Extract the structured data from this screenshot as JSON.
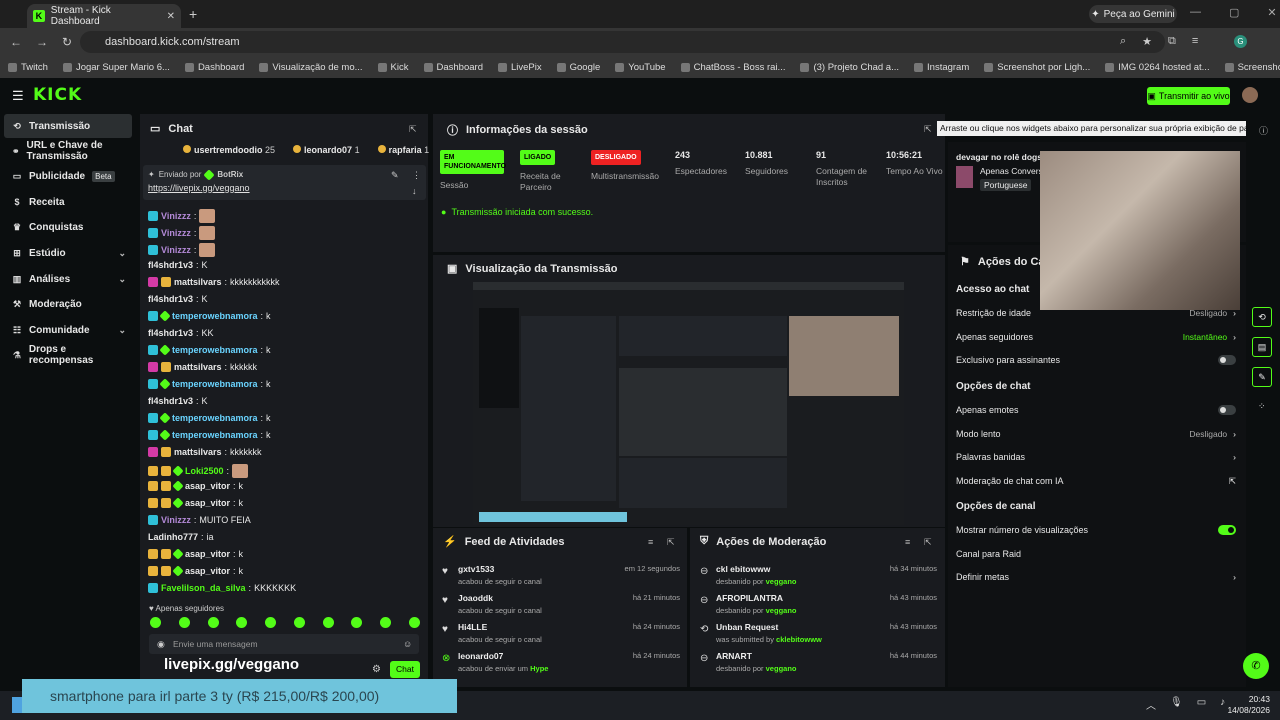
{
  "browser": {
    "tab_title": "Stream - Kick Dashboard",
    "gemini_label": "Peça ao Gemini",
    "url": "dashboard.kick.com/stream",
    "bookmarks": [
      "Twitch",
      "Jogar Super Mario 6...",
      "Dashboard",
      "Visualização de mo...",
      "Kick",
      "Dashboard",
      "LivePix",
      "Google",
      "YouTube",
      "ChatBoss - Boss rai...",
      "(3) Projeto Chad a...",
      "Instagram",
      "Screenshot por Ligh...",
      "IMG 0264 hosted at...",
      "Screenshot por Ligh..."
    ]
  },
  "header": {
    "logo": "KICK",
    "live_button": "Transmitir ao vivo"
  },
  "sidebar": {
    "items": [
      {
        "label": "Transmissão",
        "icon": "broadcast-icon"
      },
      {
        "label": "URL e Chave de Transmissão",
        "icon": "key-icon"
      },
      {
        "label": "Publicidade",
        "icon": "ads-icon",
        "badge": "Beta"
      },
      {
        "label": "Receita",
        "icon": "dollar-icon"
      },
      {
        "label": "Conquistas",
        "icon": "trophy-icon"
      },
      {
        "label": "Estúdio",
        "icon": "studio-icon"
      },
      {
        "label": "Análises",
        "icon": "chart-icon"
      },
      {
        "label": "Moderação",
        "icon": "hammer-icon"
      },
      {
        "label": "Comunidade",
        "icon": "community-icon"
      },
      {
        "label": "Drops e recompensas",
        "icon": "gift-icon"
      }
    ]
  },
  "chat": {
    "title": "Chat",
    "gifters": [
      {
        "name": "usertremdoodio",
        "count": "25"
      },
      {
        "name": "leonardo07",
        "count": "1"
      },
      {
        "name": "rapfaria",
        "count": "1"
      }
    ],
    "pinned": {
      "sent_by": "Enviado por",
      "bot": "BotRix",
      "link": "https://livepix.gg/veggano"
    },
    "messages": [
      {
        "user": "Vinizzz",
        "text": "",
        "color": "#b48ad8",
        "emote": true
      },
      {
        "user": "Vinizzz",
        "text": "",
        "color": "#b48ad8",
        "emote": true
      },
      {
        "user": "Vinizzz",
        "text": "",
        "color": "#b48ad8",
        "emote": true
      },
      {
        "user": "fl4shdr1v3",
        "text": "K",
        "color": "#e8e8e8"
      },
      {
        "user": "mattsilvars",
        "text": "kkkkkkkkkkk",
        "color": "#e8e8e8"
      },
      {
        "user": "fl4shdr1v3",
        "text": "K",
        "color": "#e8e8e8"
      },
      {
        "user": "temperowebnamora",
        "text": "k",
        "color": "#6ad4ff"
      },
      {
        "user": "fl4shdr1v3",
        "text": "KK",
        "color": "#e8e8e8"
      },
      {
        "user": "temperowebnamora",
        "text": "k",
        "color": "#6ad4ff"
      },
      {
        "user": "mattsilvars",
        "text": "kkkkkk",
        "color": "#e8e8e8"
      },
      {
        "user": "temperowebnamora",
        "text": "k",
        "color": "#6ad4ff"
      },
      {
        "user": "fl4shdr1v3",
        "text": "K",
        "color": "#e8e8e8"
      },
      {
        "user": "temperowebnamora",
        "text": "k",
        "color": "#6ad4ff"
      },
      {
        "user": "temperowebnamora",
        "text": "k",
        "color": "#6ad4ff"
      },
      {
        "user": "mattsilvars",
        "text": "kkkkkkk",
        "color": "#e8e8e8"
      },
      {
        "user": "Loki2500",
        "text": "",
        "color": "#53fc18",
        "emote": true
      },
      {
        "user": "asap_vitor",
        "text": "k",
        "color": "#e8e8e8"
      },
      {
        "user": "asap_vitor",
        "text": "k",
        "color": "#e8e8e8"
      },
      {
        "user": "Vinizzz",
        "text": "MUITO FEIA",
        "color": "#b48ad8"
      },
      {
        "user": "Ladinho777",
        "text": "ia",
        "color": "#e8e8e8"
      },
      {
        "user": "asap_vitor",
        "text": "k",
        "color": "#e8e8e8"
      },
      {
        "user": "asap_vitor",
        "text": "k",
        "color": "#e8e8e8"
      },
      {
        "user": "Favelilson_da_silva",
        "text": "KKKKKKK",
        "color": "#53fc18"
      }
    ],
    "follow_only": "Apenas seguidores",
    "input_placeholder": "Envie uma mensagem",
    "send_label": "Chat",
    "overlay_url": "livepix.gg/veggano"
  },
  "session": {
    "title": "Informações da sessão",
    "stats": [
      {
        "pill": "EM FUNCIONAMENTO",
        "label": "Sessão"
      },
      {
        "pill": "LIGADO",
        "label": "Receita de Parceiro"
      },
      {
        "pill": "DESLIGADO",
        "label": "Multistransmissão"
      },
      {
        "value": "243",
        "label": "Espectadores"
      },
      {
        "value": "10.881",
        "label": "Seguidores"
      },
      {
        "value": "91",
        "label": "Contagem de Inscritos"
      },
      {
        "value": "10:56:21",
        "label": "Tempo Ao Vivo"
      }
    ],
    "success": "Transmissão iniciada com sucesso."
  },
  "preview": {
    "title": "Visualização da Transmissão"
  },
  "feed": {
    "title": "Feed de Atividades",
    "items": [
      {
        "user": "gxtv1533",
        "desc": "acabou de seguir o canal",
        "time": "em 12 segundos"
      },
      {
        "user": "Joaoddk",
        "desc": "acabou de seguir o canal",
        "time": "há 21 minutos"
      },
      {
        "user": "Hi4LLE",
        "desc": "acabou de seguir o canal",
        "time": "há 24 minutos"
      },
      {
        "user": "leonardo07",
        "desc": "acabou de enviar um",
        "extra": "Hype",
        "time": "há 24 minutos"
      }
    ]
  },
  "moderation": {
    "title": "Ações de Moderação",
    "items": [
      {
        "user": "ckl ebitowww",
        "desc": "desbanido por",
        "by": "veggano",
        "time": "há 34 minutos"
      },
      {
        "user": "AFROPILANTRA",
        "desc": "desbanido por",
        "by": "veggano",
        "time": "há 43 minutos"
      },
      {
        "user": "Unban Request",
        "desc": "was submitted by",
        "by": "cklebitowww",
        "time": "há 43 minutos"
      },
      {
        "user": "ARNART",
        "desc": "desbanido por",
        "by": "veggano",
        "time": "há 44 minutos"
      }
    ]
  },
  "tooltip": "Arraste ou clique nos widgets abaixo para personalizar sua própria exibição de painel",
  "stream_info": {
    "title": "devagar no rolê dogs | !",
    "category": "Apenas Conversa",
    "language": "Portuguese"
  },
  "actions": {
    "title": "Ações do Canal",
    "sections": [
      {
        "header": "Acesso ao chat",
        "rows": [
          {
            "label": "Restrição de idade",
            "value": "Desligado",
            "type": "chev"
          },
          {
            "label": "Apenas seguidores",
            "value": "Instantâneo",
            "type": "chev",
            "accent": true
          },
          {
            "label": "Exclusivo para assinantes",
            "type": "toggle",
            "on": false
          }
        ]
      },
      {
        "header": "Opções de chat",
        "rows": [
          {
            "label": "Apenas emotes",
            "type": "toggle",
            "on": false
          },
          {
            "label": "Modo lento",
            "value": "Desligado",
            "type": "chev"
          },
          {
            "label": "Palavras banidas",
            "type": "chev"
          },
          {
            "label": "Moderação de chat com IA",
            "type": "ext"
          }
        ]
      },
      {
        "header": "Opções de canal",
        "rows": [
          {
            "label": "Mostrar número de visualizações",
            "type": "toggle",
            "on": true
          },
          {
            "label": "Canal para Raid",
            "type": "none"
          },
          {
            "label": "Definir metas",
            "type": "chev"
          }
        ]
      }
    ]
  },
  "banner": "smartphone para irl parte 3 ty (R$ 215,00/R$ 200,00)",
  "taskbar": {
    "time": "20:43",
    "date": "14/08/2026"
  },
  "colors": {
    "accent": "#53fc18",
    "panel": "#191b1f",
    "bg": "#0b0e0f"
  }
}
